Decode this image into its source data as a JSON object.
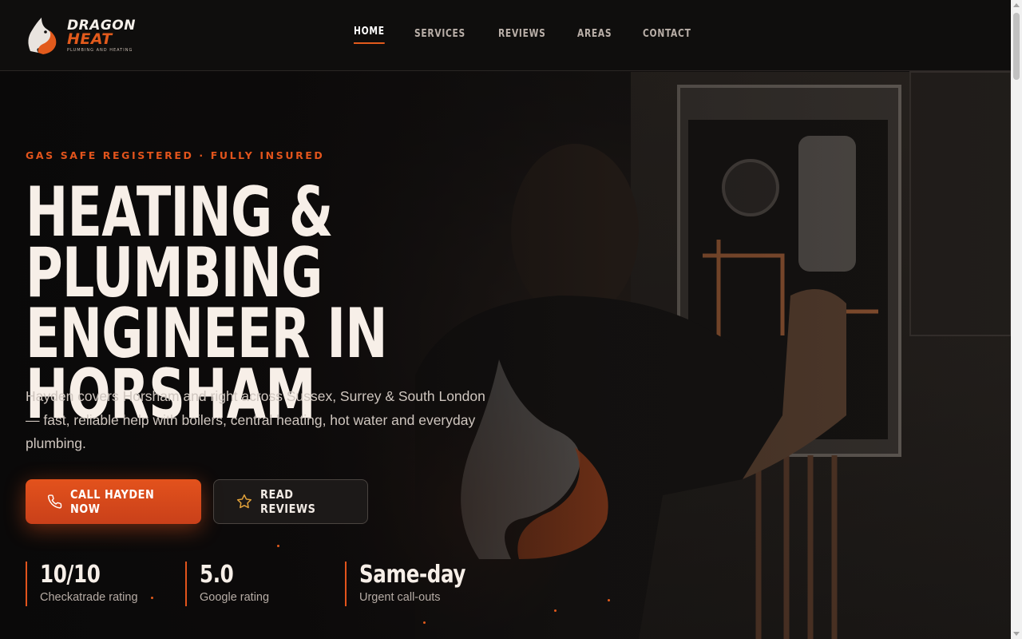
{
  "brand": {
    "line1": "DRAGON",
    "line2": "HEAT",
    "tagline": "PLUMBING AND HEATING",
    "accent": "#e2541c"
  },
  "nav": {
    "items": [
      {
        "label": "HOME",
        "active": true
      },
      {
        "label": "SERVICES",
        "active": false
      },
      {
        "label": "REVIEWS",
        "active": false
      },
      {
        "label": "AREAS",
        "active": false
      },
      {
        "label": "CONTACT",
        "active": false
      }
    ]
  },
  "hero": {
    "eyebrow": "GAS SAFE REGISTERED · FULLY INSURED",
    "title_line1": "HEATING & PLUMBING",
    "title_line2": "ENGINEER IN",
    "title_line3": "HORSHAM",
    "lead": "Hayden covers Horsham and right across Sussex, Surrey & South London — fast, reliable help with boilers, central heating, hot water and everyday plumbing.",
    "cta_primary": {
      "label": "CALL HAYDEN NOW",
      "icon": "phone-icon"
    },
    "cta_secondary": {
      "label": "READ REVIEWS",
      "icon": "star-icon"
    }
  },
  "stats": [
    {
      "value": "10/10",
      "label": "Checkatrade rating"
    },
    {
      "value": "5.0",
      "label": "Google rating"
    },
    {
      "value": "Same-day",
      "label": "Urgent call-outs"
    }
  ]
}
